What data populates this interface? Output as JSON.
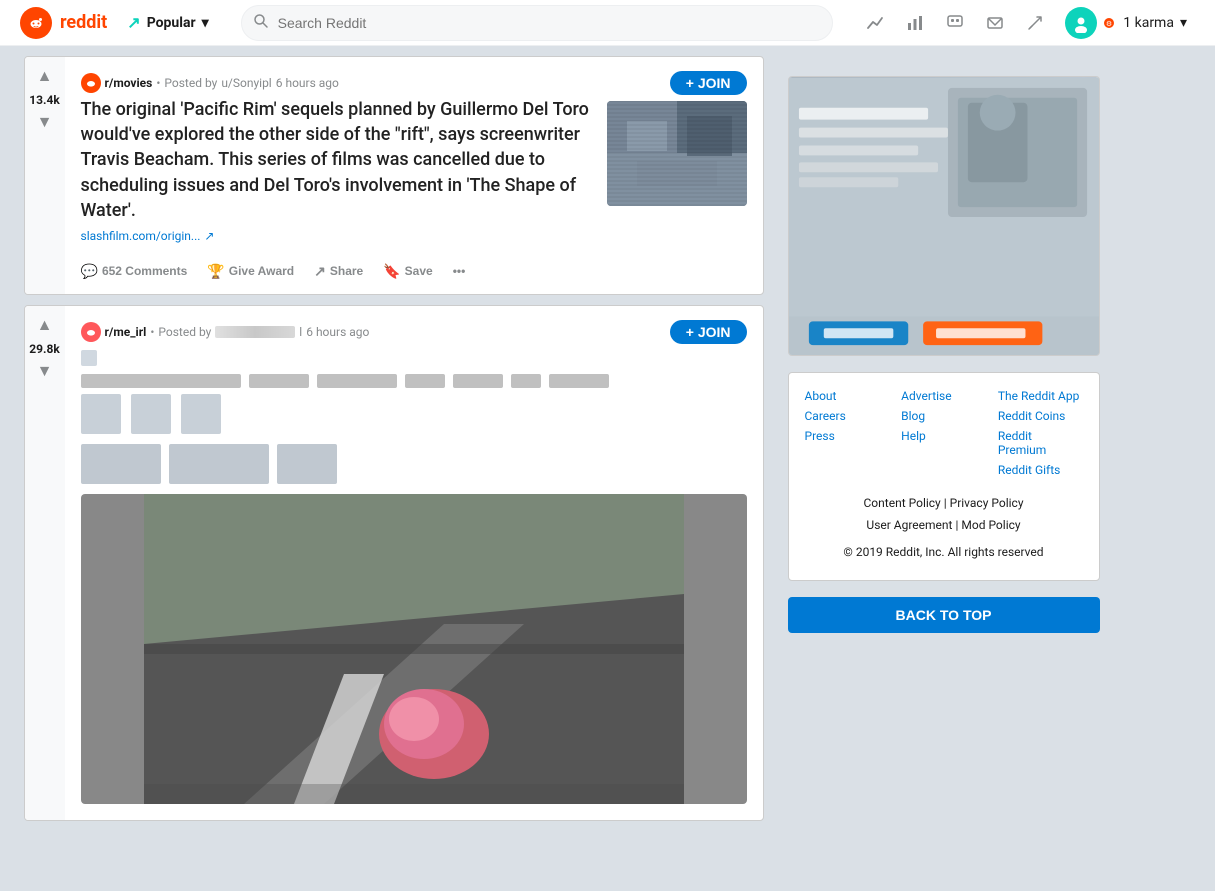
{
  "header": {
    "logo_text": "reddit",
    "popular_label": "Popular",
    "search_placeholder": "Search Reddit",
    "karma_label": "1 karma",
    "chevron": "▾",
    "icons": {
      "trending": "📈",
      "chart": "📊",
      "chat_bubbles": "⬜",
      "messages": "✉",
      "edit": "✏"
    }
  },
  "posts": [
    {
      "id": "post1",
      "subreddit": "r/movies",
      "subreddit_short": "m",
      "posted_by": "u/Sonyipl",
      "time_ago": "6 hours ago",
      "vote_count": "13.4k",
      "title": "The original 'Pacific Rim' sequels planned by Guillermo Del Toro would've explored the other side of the \"rift\", says screenwriter Travis Beacham. This series of films was cancelled due to scheduling issues and Del Toro's involvement in 'The Shape of Water'.",
      "link_text": "slashfilm.com/origin...",
      "link_icon": "↗",
      "comments_count": "652",
      "comments_label": "652 Comments",
      "award_label": "Give Award",
      "share_label": "Share",
      "save_label": "Save",
      "more_label": "•••",
      "join_label": "+ JOIN"
    },
    {
      "id": "post2",
      "subreddit": "r/me_irl",
      "subreddit_short": "r",
      "posted_by": "u/[user]",
      "time_ago": "6 hours ago",
      "vote_count": "29.8k",
      "title": "[blurred content]",
      "join_label": "+ JOIN",
      "has_image": true
    }
  ],
  "sidebar": {
    "footer": {
      "links": [
        {
          "label": "About"
        },
        {
          "label": "Advertise"
        },
        {
          "label": "The Reddit App"
        },
        {
          "label": "Careers"
        },
        {
          "label": "Blog"
        },
        {
          "label": "Reddit Coins"
        },
        {
          "label": "Press"
        },
        {
          "label": "Help"
        },
        {
          "label": "Reddit Premium"
        },
        {
          "label": ""
        },
        {
          "label": ""
        },
        {
          "label": "Reddit Gifts"
        }
      ],
      "policy_links": [
        "Content Policy",
        "Privacy Policy",
        "User Agreement",
        "Mod Policy"
      ],
      "copyright": "© 2019 Reddit, Inc. All rights reserved"
    },
    "back_to_top": "BACK TO TOP"
  }
}
